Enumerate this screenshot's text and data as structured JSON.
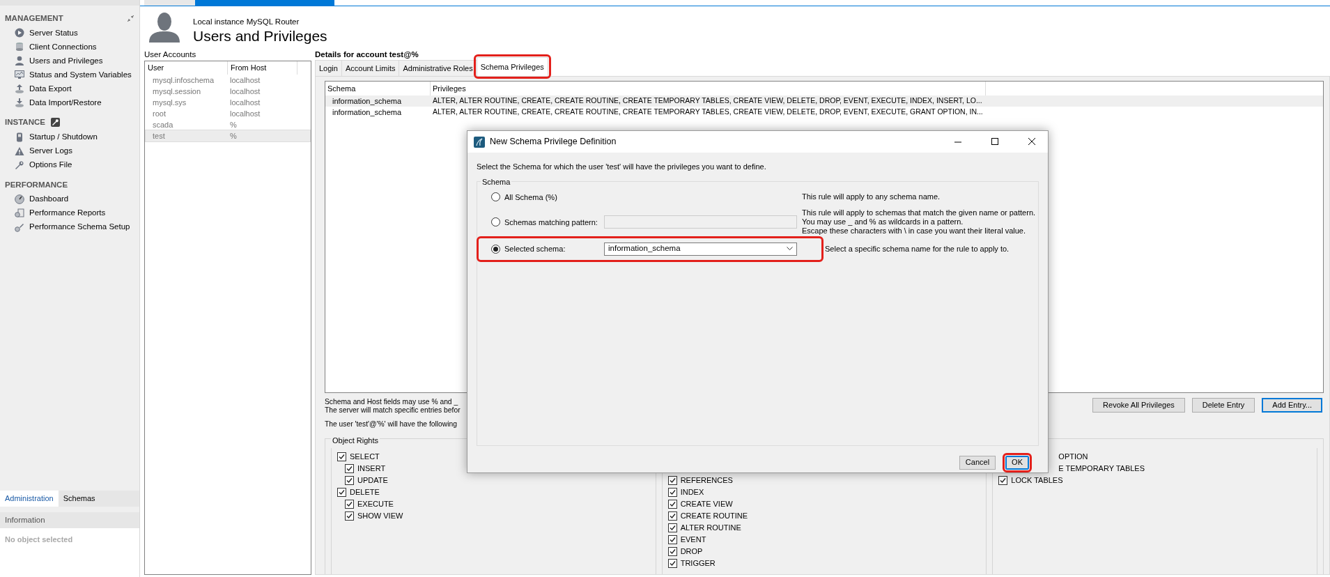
{
  "sidebar": {
    "sections": [
      {
        "title": "MANAGEMENT",
        "items": [
          "Server Status",
          "Client Connections",
          "Users and Privileges",
          "Status and System Variables",
          "Data Export",
          "Data Import/Restore"
        ]
      },
      {
        "title": "INSTANCE",
        "items": [
          "Startup / Shutdown",
          "Server Logs",
          "Options File"
        ]
      },
      {
        "title": "PERFORMANCE",
        "items": [
          "Dashboard",
          "Performance Reports",
          "Performance Schema Setup"
        ]
      }
    ],
    "tabs": [
      {
        "label": "Administration",
        "selected": true
      },
      {
        "label": "Schemas",
        "selected": false
      }
    ],
    "information": {
      "title": "Information",
      "text": "No object selected"
    }
  },
  "header": {
    "subtitle": "Local instance MySQL Router",
    "title": "Users and Privileges"
  },
  "user_accounts": {
    "label": "User Accounts",
    "columns": [
      "User",
      "From Host"
    ],
    "rows": [
      {
        "user": "mysql.infoschema",
        "host": "localhost",
        "selected": false
      },
      {
        "user": "mysql.session",
        "host": "localhost",
        "selected": false
      },
      {
        "user": "mysql.sys",
        "host": "localhost",
        "selected": false
      },
      {
        "user": "root",
        "host": "localhost",
        "selected": false
      },
      {
        "user": "scada",
        "host": "%",
        "selected": false
      },
      {
        "user": "test",
        "host": "%",
        "selected": true
      }
    ]
  },
  "details": {
    "title": "Details for account test@%",
    "tabs": [
      {
        "label": "Login",
        "selected": false,
        "highlighted": false
      },
      {
        "label": "Account Limits",
        "selected": false,
        "highlighted": false
      },
      {
        "label": "Administrative Roles",
        "selected": false,
        "highlighted": false
      },
      {
        "label": "Schema Privileges",
        "selected": true,
        "highlighted": true
      }
    ],
    "schema_table": {
      "columns": [
        "Schema",
        "Privileges"
      ],
      "rows": [
        {
          "schema": "information_schema",
          "privileges": "ALTER, ALTER ROUTINE, CREATE, CREATE ROUTINE, CREATE TEMPORARY TABLES, CREATE VIEW, DELETE, DROP, EVENT, EXECUTE, INDEX, INSERT, LO...",
          "selected": true
        },
        {
          "schema": "information_schema",
          "privileges": "ALTER, ALTER ROUTINE, CREATE, CREATE ROUTINE, CREATE TEMPORARY TABLES, CREATE VIEW, DELETE, DROP, EVENT, EXECUTE, GRANT OPTION, IN...",
          "selected": false
        }
      ]
    },
    "notes": "Schema and Host fields may use % and _\nThe server will match specific entries befor",
    "user_note": "The user 'test'@'%' will have the following",
    "buttons": [
      {
        "label": "Revoke All Privileges",
        "default": false
      },
      {
        "label": "Delete Entry",
        "default": false
      },
      {
        "label": "Add Entry...",
        "default": true
      }
    ],
    "object_rights": {
      "title": "Object Rights",
      "columns": [
        [
          {
            "kind": "checkbox",
            "label": "SELECT",
            "checked": true,
            "children": [
              {
                "kind": "checkbox",
                "label": "INSERT",
                "checked": true
              },
              {
                "kind": "checkbox",
                "label": "UPDATE",
                "checked": true
              }
            ]
          },
          {
            "kind": "checkbox",
            "label": "DELETE",
            "checked": true,
            "children": [
              {
                "kind": "checkbox",
                "label": "EXECUTE",
                "checked": true
              },
              {
                "kind": "checkbox",
                "label": "SHOW VIEW",
                "checked": true
              }
            ]
          }
        ],
        [
          {
            "kind": "checkbox",
            "label": "REFERENCES",
            "checked": true
          },
          {
            "kind": "checkbox",
            "label": "INDEX",
            "checked": true
          },
          {
            "kind": "checkbox",
            "label": "CREATE VIEW",
            "checked": true
          },
          {
            "kind": "checkbox",
            "label": "CREATE ROUTINE",
            "checked": true
          },
          {
            "kind": "checkbox",
            "label": "ALTER ROUTINE",
            "checked": true
          },
          {
            "kind": "checkbox",
            "label": "EVENT",
            "checked": true
          },
          {
            "kind": "checkbox",
            "label": "DROP",
            "checked": true
          },
          {
            "kind": "checkbox",
            "label": "TRIGGER",
            "checked": true
          }
        ],
        [
          {
            "kind": "covered",
            "label": "OPTION"
          },
          {
            "kind": "covered",
            "label": "E TEMPORARY TABLES"
          },
          {
            "kind": "checkbox",
            "label": "LOCK TABLES",
            "checked": true
          }
        ]
      ]
    }
  },
  "dialog": {
    "title": "New Schema Privilege Definition",
    "description": "Select the Schema for which the user 'test' will have the privileges you want to define.",
    "group": "Schema",
    "options": [
      {
        "kind": "none",
        "label": "All Schema (%)",
        "selected": false,
        "highlighted": false,
        "description": "This rule will apply to any schema name."
      },
      {
        "kind": "text",
        "label": "Schemas matching pattern:",
        "selected": false,
        "highlighted": false,
        "description": "This rule will apply to schemas that match the given name or pattern.\nYou may use _ and % as wildcards in a pattern.\nEscape these characters with \\ in case you want their literal value."
      },
      {
        "kind": "select",
        "label": "Selected schema:",
        "value": "information_schema",
        "selected": true,
        "highlighted": true,
        "description": "Select a specific schema name for the rule to apply to."
      }
    ],
    "buttons": [
      {
        "label": "Cancel",
        "default": false,
        "highlighted": false
      },
      {
        "label": "OK",
        "default": true,
        "highlighted": true
      }
    ]
  }
}
